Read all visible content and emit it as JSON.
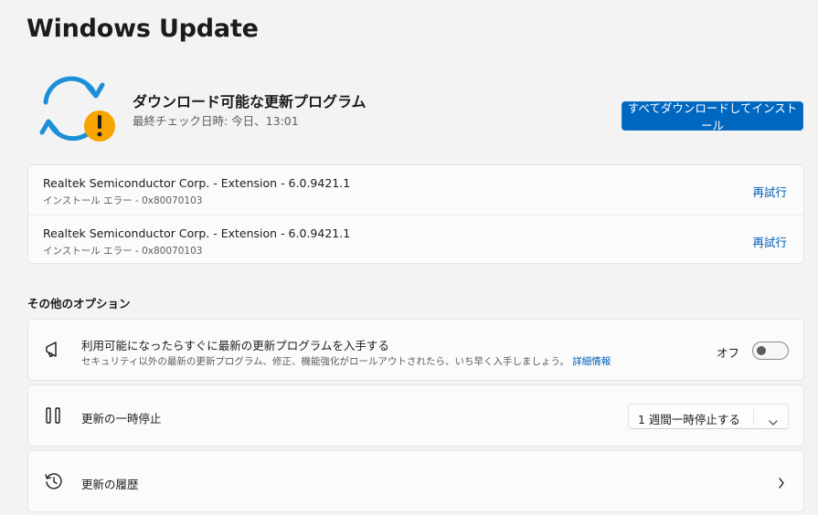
{
  "page": {
    "title": "Windows Update"
  },
  "status": {
    "icon": "sync-warning-icon",
    "title": "ダウンロード可能な更新プログラム",
    "last_checked": "最終チェック日時: 今日、13:01",
    "install_all_label": "すべてダウンロードしてインストール",
    "accent": "#0067c0",
    "warning_color": "#f7a300"
  },
  "updates": [
    {
      "name": "Realtek Semiconductor Corp. - Extension - 6.0.9421.1",
      "error": "インストール エラー - 0x80070103",
      "action": "再試行"
    },
    {
      "name": "Realtek Semiconductor Corp. - Extension - 6.0.9421.1",
      "error": "インストール エラー - 0x80070103",
      "action": "再試行"
    }
  ],
  "options": {
    "section_label": "その他のオプション",
    "latest": {
      "icon": "megaphone-icon",
      "title": "利用可能になったらすぐに最新の更新プログラムを入手する",
      "description": "セキュリティ以外の最新の更新プログラム、修正、機能強化がロールアウトされたら、いち早く入手しましょう。",
      "link": "詳細情報",
      "toggle_label": "オフ",
      "toggle_on": false
    },
    "pause": {
      "icon": "pause-icon",
      "title": "更新の一時停止",
      "selected": "1 週間一時停止する"
    },
    "history": {
      "icon": "history-icon",
      "title": "更新の履歴"
    }
  }
}
